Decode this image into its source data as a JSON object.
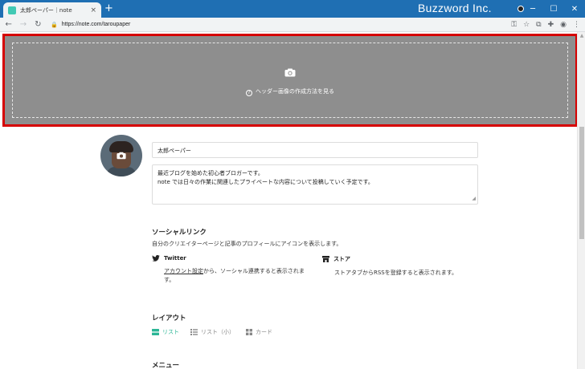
{
  "browser": {
    "tab_title": "太郎ペーパー｜note",
    "tab_close": "×",
    "new_tab": "+",
    "watermark": "Buzzword Inc.",
    "window_minimize": "─",
    "window_maximize": "☐",
    "window_close": "✕",
    "back": "←",
    "forward": "→",
    "reload": "↻",
    "url": "https://note.com/taroupaper",
    "lock": "🔒",
    "key": "⚿",
    "star": "☆",
    "ext": "⧉",
    "puzzle": "✚",
    "account": "◉",
    "menu": "⋮"
  },
  "banner": {
    "help_text": "ヘッダー画像の作成方法を見る",
    "help_icon": "?"
  },
  "profile": {
    "name": "太郎ペーパー",
    "bio_line1": "最近ブログを始めた初心者ブロガーです。",
    "bio_line2": "note では日々の作業に関連したプライベートな内容について投稿していく予定です。"
  },
  "social": {
    "title": "ソーシャルリンク",
    "desc": "自分のクリエイターページと記事のプロフィールにアイコンを表示します。",
    "twitter_label": "Twitter",
    "twitter_link": "アカウント設定",
    "twitter_desc_line1": "から、ソーシャル連携すると表示されま",
    "twitter_desc_line2": "す。",
    "store_label": "ストア",
    "store_desc": "ストアタブからRSSを登録すると表示されます。"
  },
  "layout": {
    "title": "レイアウト",
    "options": [
      "リスト",
      "リスト（小）",
      "カード"
    ]
  },
  "menu": {
    "title": "メニュー"
  },
  "colors": {
    "accent": "#2cb696",
    "banner_border": "#d60000",
    "titlebar": "#1f6fb3"
  }
}
